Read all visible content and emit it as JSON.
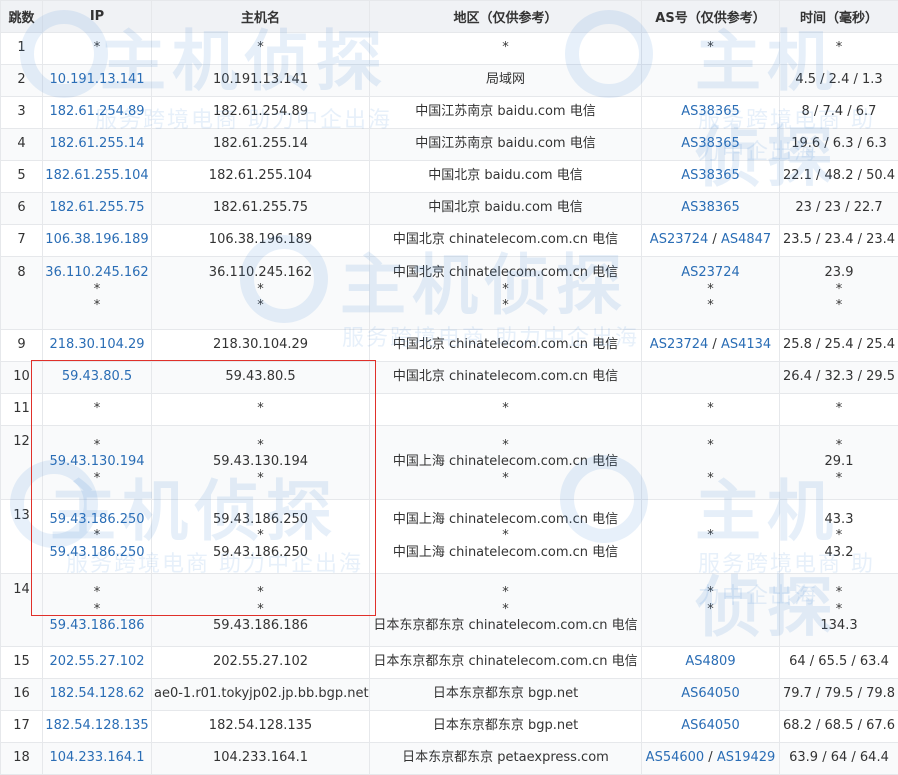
{
  "headers": {
    "hop": "跳数",
    "ip": "IP",
    "host": "主机名",
    "region": "地区（仅供参考）",
    "asn": "AS号（仅供参考）",
    "time": "时间（毫秒）"
  },
  "rows": [
    {
      "hop": "1",
      "ip": [
        "*"
      ],
      "host": [
        "*"
      ],
      "region": [
        "*"
      ],
      "asn": [
        [
          "*"
        ]
      ],
      "time": [
        "*"
      ]
    },
    {
      "hop": "2",
      "ip": [
        "10.191.13.141"
      ],
      "host": [
        "10.191.13.141"
      ],
      "region": [
        "局域网"
      ],
      "asn": [
        []
      ],
      "time": [
        "4.5 / 2.4 / 1.3"
      ]
    },
    {
      "hop": "3",
      "ip": [
        "182.61.254.89"
      ],
      "host": [
        "182.61.254.89"
      ],
      "region": [
        "中国江苏南京 baidu.com 电信"
      ],
      "asn": [
        [
          "AS38365"
        ]
      ],
      "time": [
        "8 / 7.4 / 6.7"
      ]
    },
    {
      "hop": "4",
      "ip": [
        "182.61.255.14"
      ],
      "host": [
        "182.61.255.14"
      ],
      "region": [
        "中国江苏南京 baidu.com 电信"
      ],
      "asn": [
        [
          "AS38365"
        ]
      ],
      "time": [
        "19.6 / 6.3 / 6.3"
      ]
    },
    {
      "hop": "5",
      "ip": [
        "182.61.255.104"
      ],
      "host": [
        "182.61.255.104"
      ],
      "region": [
        "中国北京 baidu.com 电信"
      ],
      "asn": [
        [
          "AS38365"
        ]
      ],
      "time": [
        "22.1 / 48.2 / 50.4"
      ]
    },
    {
      "hop": "6",
      "ip": [
        "182.61.255.75"
      ],
      "host": [
        "182.61.255.75"
      ],
      "region": [
        "中国北京 baidu.com 电信"
      ],
      "asn": [
        [
          "AS38365"
        ]
      ],
      "time": [
        "23 / 23 / 22.7"
      ]
    },
    {
      "hop": "7",
      "ip": [
        "106.38.196.189"
      ],
      "host": [
        "106.38.196.189"
      ],
      "region": [
        "中国北京 chinatelecom.com.cn 电信"
      ],
      "asn": [
        [
          "AS23724",
          "AS4847"
        ]
      ],
      "time": [
        "23.5 / 23.4 / 23.4"
      ]
    },
    {
      "hop": "8",
      "ip": [
        "36.110.245.162",
        "*",
        "*"
      ],
      "host": [
        "36.110.245.162",
        "*",
        "*"
      ],
      "region": [
        "中国北京 chinatelecom.com.cn 电信",
        "*",
        "*"
      ],
      "asn": [
        [
          "AS23724"
        ],
        [
          "*"
        ],
        [
          "*"
        ]
      ],
      "time": [
        "23.9",
        "*",
        "*"
      ]
    },
    {
      "hop": "9",
      "ip": [
        "218.30.104.29"
      ],
      "host": [
        "218.30.104.29"
      ],
      "region": [
        "中国北京 chinatelecom.com.cn 电信"
      ],
      "asn": [
        [
          "AS23724",
          "AS4134"
        ]
      ],
      "time": [
        "25.8 / 25.4 / 25.4"
      ]
    },
    {
      "hop": "10",
      "ip": [
        "59.43.80.5"
      ],
      "host": [
        "59.43.80.5"
      ],
      "region": [
        "中国北京 chinatelecom.com.cn 电信"
      ],
      "asn": [
        []
      ],
      "time": [
        "26.4 / 32.3 / 29.5"
      ]
    },
    {
      "hop": "11",
      "ip": [
        "*"
      ],
      "host": [
        "*"
      ],
      "region": [
        "*"
      ],
      "asn": [
        [
          "*"
        ]
      ],
      "time": [
        "*"
      ]
    },
    {
      "hop": "12",
      "ip": [
        "*",
        "59.43.130.194",
        "*"
      ],
      "host": [
        "*",
        "59.43.130.194",
        "*"
      ],
      "region": [
        "*",
        "中国上海 chinatelecom.com.cn 电信",
        "*"
      ],
      "asn": [
        [
          "*"
        ],
        [],
        [
          "*"
        ]
      ],
      "time": [
        "*",
        "29.1",
        "*"
      ]
    },
    {
      "hop": "13",
      "ip": [
        "59.43.186.250",
        "*",
        "59.43.186.250"
      ],
      "host": [
        "59.43.186.250",
        "*",
        "59.43.186.250"
      ],
      "region": [
        "中国上海 chinatelecom.com.cn 电信",
        "*",
        "中国上海 chinatelecom.com.cn 电信"
      ],
      "asn": [
        [],
        [
          "*"
        ],
        []
      ],
      "time": [
        "43.3",
        "*",
        "43.2"
      ]
    },
    {
      "hop": "14",
      "ip": [
        "*",
        "*",
        "59.43.186.186"
      ],
      "host": [
        "*",
        "*",
        "59.43.186.186"
      ],
      "region": [
        "*",
        "*",
        "日本东京都东京 chinatelecom.com.cn 电信"
      ],
      "asn": [
        [
          "*"
        ],
        [
          "*"
        ],
        []
      ],
      "time": [
        "*",
        "*",
        "134.3"
      ]
    },
    {
      "hop": "15",
      "ip": [
        "202.55.27.102"
      ],
      "host": [
        "202.55.27.102"
      ],
      "region": [
        "日本东京都东京 chinatelecom.com.cn 电信"
      ],
      "asn": [
        [
          "AS4809"
        ]
      ],
      "time": [
        "64 / 65.5 / 63.4"
      ]
    },
    {
      "hop": "16",
      "ip": [
        "182.54.128.62"
      ],
      "host": [
        "ae0-1.r01.tokyjp02.jp.bb.bgp.net"
      ],
      "region": [
        "日本东京都东京 bgp.net"
      ],
      "asn": [
        [
          "AS64050"
        ]
      ],
      "time": [
        "79.7 / 79.5 / 79.8"
      ]
    },
    {
      "hop": "17",
      "ip": [
        "182.54.128.135"
      ],
      "host": [
        "182.54.128.135"
      ],
      "region": [
        "日本东京都东京 bgp.net"
      ],
      "asn": [
        [
          "AS64050"
        ]
      ],
      "time": [
        "68.2 / 68.5 / 67.6"
      ]
    },
    {
      "hop": "18",
      "ip": [
        "104.233.164.1"
      ],
      "host": [
        "104.233.164.1"
      ],
      "region": [
        "日本东京都东京 petaexpress.com"
      ],
      "asn": [
        [
          "AS54600",
          "AS19429"
        ]
      ],
      "time": [
        "63.9 / 64 / 64.4"
      ]
    }
  ],
  "watermark": {
    "logo_text": "主机侦探",
    "slogan": "服务跨境电商 助力中企出海"
  },
  "colors": {
    "link": "#2a6db5",
    "header_bg": "#f0f2f5",
    "highlight_border": "#e0302a"
  }
}
